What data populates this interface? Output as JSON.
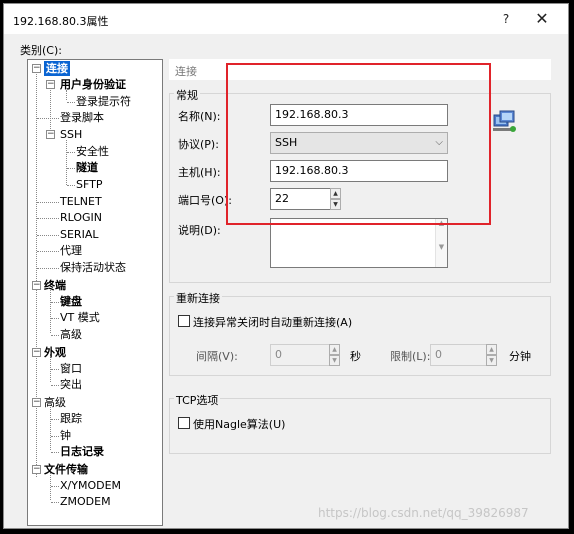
{
  "window": {
    "title": "192.168.80.3属性",
    "help": "?",
    "close": "✕"
  },
  "category_label": "类别(C):",
  "tree": {
    "items": [
      {
        "label": "连接"
      },
      {
        "label": "用户身份验证"
      },
      {
        "label": "登录提示符"
      },
      {
        "label": "登录脚本"
      },
      {
        "label": "SSH"
      },
      {
        "label": "安全性"
      },
      {
        "label": "隧道"
      },
      {
        "label": "SFTP"
      },
      {
        "label": "TELNET"
      },
      {
        "label": "RLOGIN"
      },
      {
        "label": "SERIAL"
      },
      {
        "label": "代理"
      },
      {
        "label": "保持活动状态"
      },
      {
        "label": "终端"
      },
      {
        "label": "键盘"
      },
      {
        "label": "VT 模式"
      },
      {
        "label": "高级"
      },
      {
        "label": "外观"
      },
      {
        "label": "窗口"
      },
      {
        "label": "突出"
      },
      {
        "label": "高级"
      },
      {
        "label": "跟踪"
      },
      {
        "label": "钟"
      },
      {
        "label": "日志记录"
      },
      {
        "label": "文件传输"
      },
      {
        "label": "X/YMODEM"
      },
      {
        "label": "ZMODEM"
      }
    ]
  },
  "panel": {
    "header": "连接",
    "general": {
      "legend": "常规",
      "name_label": "名称(N):",
      "name_value": "192.168.80.3",
      "protocol_label": "协议(P):",
      "protocol_value": "SSH",
      "host_label": "主机(H):",
      "host_value": "192.168.80.3",
      "port_label": "端口号(O):",
      "port_value": "22",
      "desc_label": "说明(D):"
    },
    "reconnect": {
      "legend": "重新连接",
      "checkbox_label": "连接异常关闭时自动重新连接(A)",
      "interval_label": "间隔(V):",
      "interval_value": "0",
      "interval_unit": "秒",
      "limit_label": "限制(L):",
      "limit_value": "0",
      "limit_unit": "分钟"
    },
    "tcp": {
      "legend": "TCP选项",
      "checkbox_label": "使用Nagle算法(U)"
    }
  },
  "watermark": "https://blog.csdn.net/qq_39826987",
  "colors": {
    "selection": "#0a64d2",
    "highlight_box": "#e0232a"
  }
}
